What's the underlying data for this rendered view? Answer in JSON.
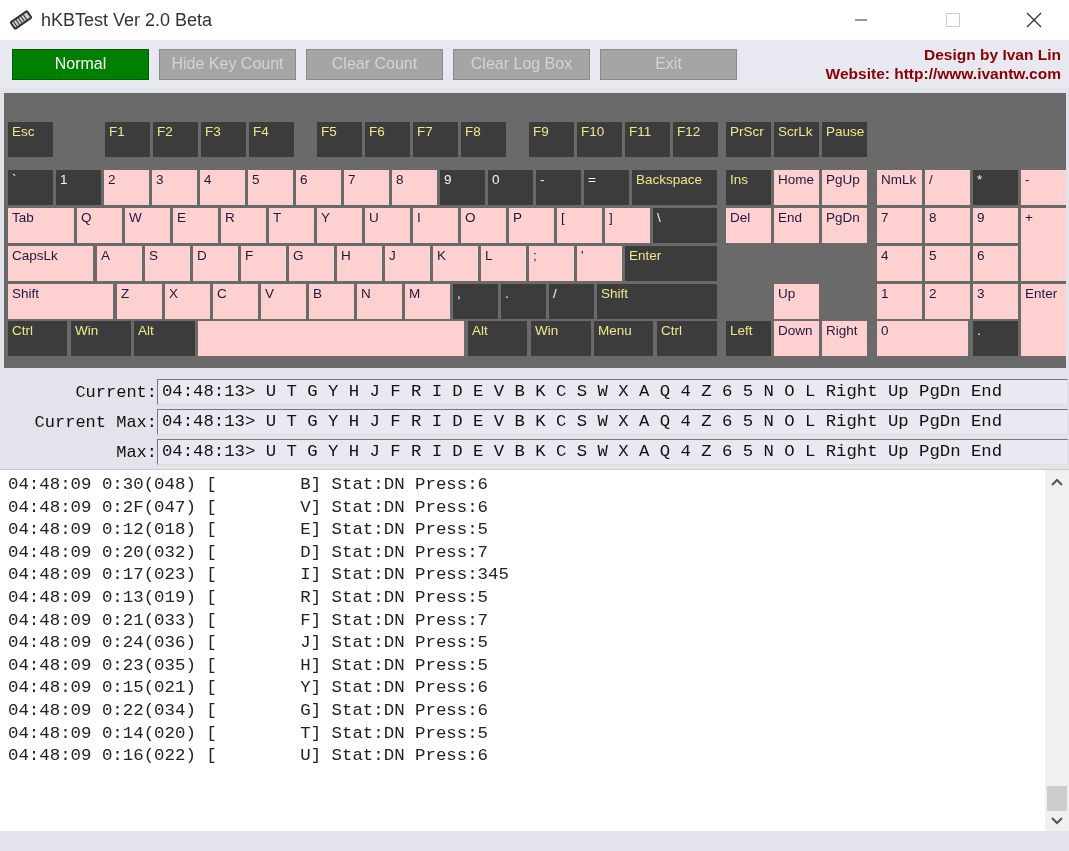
{
  "window": {
    "title": "hKBTest Ver 2.0 Beta"
  },
  "toolbar": {
    "buttons": [
      {
        "label": "Normal",
        "disabled": false
      },
      {
        "label": "Hide Key Count",
        "disabled": true
      },
      {
        "label": "Clear Count",
        "disabled": true
      },
      {
        "label": "Clear Log Box",
        "disabled": true
      },
      {
        "label": "Exit",
        "disabled": true
      }
    ],
    "credits": [
      "Design by Ivan Lin",
      "Website: http://www.ivantw.com"
    ]
  },
  "keyboard": {
    "keys": [
      {
        "label": "Esc",
        "kind": "func",
        "pressed": false
      },
      {
        "label": "F1",
        "kind": "func",
        "pressed": false
      },
      {
        "label": "F2",
        "kind": "func",
        "pressed": false
      },
      {
        "label": "F3",
        "kind": "func",
        "pressed": false
      },
      {
        "label": "F4",
        "kind": "func",
        "pressed": false
      },
      {
        "label": "F5",
        "kind": "func",
        "pressed": false
      },
      {
        "label": "F6",
        "kind": "func",
        "pressed": false
      },
      {
        "label": "F7",
        "kind": "func",
        "pressed": false
      },
      {
        "label": "F8",
        "kind": "func",
        "pressed": false
      },
      {
        "label": "F9",
        "kind": "func",
        "pressed": false
      },
      {
        "label": "F10",
        "kind": "func",
        "pressed": false
      },
      {
        "label": "F11",
        "kind": "func",
        "pressed": false
      },
      {
        "label": "F12",
        "kind": "func",
        "pressed": false
      },
      {
        "label": "PrScr",
        "kind": "func",
        "pressed": false
      },
      {
        "label": "ScrLk",
        "kind": "func",
        "pressed": false
      },
      {
        "label": "Pause",
        "kind": "func",
        "pressed": false
      },
      {
        "label": "`",
        "kind": "char",
        "pressed": false
      },
      {
        "label": "1",
        "kind": "char",
        "pressed": false
      },
      {
        "label": "2",
        "kind": "char",
        "pressed": true
      },
      {
        "label": "3",
        "kind": "char",
        "pressed": true
      },
      {
        "label": "4",
        "kind": "char",
        "pressed": true
      },
      {
        "label": "5",
        "kind": "char",
        "pressed": true
      },
      {
        "label": "6",
        "kind": "char",
        "pressed": true
      },
      {
        "label": "7",
        "kind": "char",
        "pressed": true
      },
      {
        "label": "8",
        "kind": "char",
        "pressed": true
      },
      {
        "label": "9",
        "kind": "char",
        "pressed": false
      },
      {
        "label": "0",
        "kind": "char",
        "pressed": false
      },
      {
        "label": "-",
        "kind": "char",
        "pressed": false
      },
      {
        "label": "=",
        "kind": "char",
        "pressed": false
      },
      {
        "label": "Backspace",
        "kind": "func",
        "pressed": false
      },
      {
        "label": "Ins",
        "kind": "func",
        "pressed": false
      },
      {
        "label": "Home",
        "kind": "func",
        "pressed": true
      },
      {
        "label": "PgUp",
        "kind": "func",
        "pressed": true
      },
      {
        "label": "NmLk",
        "kind": "func",
        "pressed": true
      },
      {
        "label": "/",
        "kind": "char",
        "pressed": true
      },
      {
        "label": "*",
        "kind": "char",
        "pressed": false
      },
      {
        "label": "-",
        "kind": "char",
        "pressed": true
      },
      {
        "label": "Tab",
        "kind": "func",
        "pressed": true
      },
      {
        "label": "Q",
        "kind": "char",
        "pressed": true
      },
      {
        "label": "W",
        "kind": "char",
        "pressed": true
      },
      {
        "label": "E",
        "kind": "char",
        "pressed": true
      },
      {
        "label": "R",
        "kind": "char",
        "pressed": true
      },
      {
        "label": "T",
        "kind": "char",
        "pressed": true
      },
      {
        "label": "Y",
        "kind": "char",
        "pressed": true
      },
      {
        "label": "U",
        "kind": "char",
        "pressed": true
      },
      {
        "label": "I",
        "kind": "char",
        "pressed": true
      },
      {
        "label": "O",
        "kind": "char",
        "pressed": true
      },
      {
        "label": "P",
        "kind": "char",
        "pressed": true
      },
      {
        "label": "[",
        "kind": "char",
        "pressed": true
      },
      {
        "label": "]",
        "kind": "char",
        "pressed": true
      },
      {
        "label": "\\",
        "kind": "char",
        "pressed": false
      },
      {
        "label": "Del",
        "kind": "func",
        "pressed": true
      },
      {
        "label": "End",
        "kind": "func",
        "pressed": true
      },
      {
        "label": "PgDn",
        "kind": "func",
        "pressed": true
      },
      {
        "label": "7",
        "kind": "char",
        "pressed": true
      },
      {
        "label": "8",
        "kind": "char",
        "pressed": true
      },
      {
        "label": "9",
        "kind": "char",
        "pressed": true
      },
      {
        "label": "+",
        "kind": "char",
        "pressed": true
      },
      {
        "label": "CapsLk",
        "kind": "func",
        "pressed": true
      },
      {
        "label": "A",
        "kind": "char",
        "pressed": true
      },
      {
        "label": "S",
        "kind": "char",
        "pressed": true
      },
      {
        "label": "D",
        "kind": "char",
        "pressed": true
      },
      {
        "label": "F",
        "kind": "char",
        "pressed": true
      },
      {
        "label": "G",
        "kind": "char",
        "pressed": true
      },
      {
        "label": "H",
        "kind": "char",
        "pressed": true
      },
      {
        "label": "J",
        "kind": "char",
        "pressed": true
      },
      {
        "label": "K",
        "kind": "char",
        "pressed": true
      },
      {
        "label": "L",
        "kind": "char",
        "pressed": true
      },
      {
        "label": ";",
        "kind": "char",
        "pressed": true
      },
      {
        "label": "'",
        "kind": "char",
        "pressed": true
      },
      {
        "label": "Enter",
        "kind": "func",
        "pressed": false
      },
      {
        "label": "4",
        "kind": "char",
        "pressed": true
      },
      {
        "label": "5",
        "kind": "char",
        "pressed": true
      },
      {
        "label": "6",
        "kind": "char",
        "pressed": true
      },
      {
        "label": "Shift",
        "kind": "func",
        "pressed": true
      },
      {
        "label": "Z",
        "kind": "char",
        "pressed": true
      },
      {
        "label": "X",
        "kind": "char",
        "pressed": true
      },
      {
        "label": "C",
        "kind": "char",
        "pressed": true
      },
      {
        "label": "V",
        "kind": "char",
        "pressed": true
      },
      {
        "label": "B",
        "kind": "char",
        "pressed": true
      },
      {
        "label": "N",
        "kind": "char",
        "pressed": true
      },
      {
        "label": "M",
        "kind": "char",
        "pressed": true
      },
      {
        "label": ",",
        "kind": "char",
        "pressed": false
      },
      {
        "label": ".",
        "kind": "char",
        "pressed": false
      },
      {
        "label": "/",
        "kind": "char",
        "pressed": false
      },
      {
        "label": "Shift",
        "kind": "func",
        "pressed": false
      },
      {
        "label": "Up",
        "kind": "func",
        "pressed": true
      },
      {
        "label": "1",
        "kind": "char",
        "pressed": true
      },
      {
        "label": "2",
        "kind": "char",
        "pressed": true
      },
      {
        "label": "3",
        "kind": "char",
        "pressed": true
      },
      {
        "label": "Enter",
        "kind": "func",
        "pressed": true
      },
      {
        "label": "Ctrl",
        "kind": "func",
        "pressed": false
      },
      {
        "label": "Win",
        "kind": "func",
        "pressed": false
      },
      {
        "label": "Alt",
        "kind": "func",
        "pressed": false
      },
      {
        "kind": "char",
        "pressed": true
      },
      {
        "label": "Alt",
        "kind": "func",
        "pressed": false
      },
      {
        "label": "Win",
        "kind": "func",
        "pressed": false
      },
      {
        "label": "Menu",
        "kind": "func",
        "pressed": false
      },
      {
        "label": "Ctrl",
        "kind": "func",
        "pressed": false
      },
      {
        "label": "Left",
        "kind": "func",
        "pressed": false
      },
      {
        "label": "Down",
        "kind": "func",
        "pressed": true
      },
      {
        "label": "Right",
        "kind": "func",
        "pressed": true
      },
      {
        "label": "0",
        "kind": "char",
        "pressed": true
      },
      {
        "label": ".",
        "kind": "char",
        "pressed": false
      }
    ]
  },
  "readouts": [
    {
      "label": "Current:",
      "value": "04:48:13> U T G Y H J F R I D E V B K C S W X A Q 4 Z 6 5 N O L Right Up PgDn End"
    },
    {
      "label": "Current Max:",
      "value": "04:48:13> U T G Y H J F R I D E V B K C S W X A Q 4 Z 6 5 N O L Right Up PgDn End"
    },
    {
      "label": "Max:",
      "value": "04:48:13> U T G Y H J F R I D E V B K C S W X A Q 4 Z 6 5 N O L Right Up PgDn End"
    }
  ],
  "log": {
    "lines": [
      "04:48:09 0:30(048) [        B] Stat:DN Press:6",
      "04:48:09 0:2F(047) [        V] Stat:DN Press:6",
      "04:48:09 0:12(018) [        E] Stat:DN Press:5",
      "04:48:09 0:20(032) [        D] Stat:DN Press:7",
      "04:48:09 0:17(023) [        I] Stat:DN Press:345",
      "04:48:09 0:13(019) [        R] Stat:DN Press:5",
      "04:48:09 0:21(033) [        F] Stat:DN Press:7",
      "04:48:09 0:24(036) [        J] Stat:DN Press:5",
      "04:48:09 0:23(035) [        H] Stat:DN Press:5",
      "04:48:09 0:15(021) [        Y] Stat:DN Press:6",
      "04:48:09 0:22(034) [        G] Stat:DN Press:6",
      "04:48:09 0:14(020) [        T] Stat:DN Press:5",
      "04:48:09 0:16(022) [        U] Stat:DN Press:6"
    ]
  }
}
